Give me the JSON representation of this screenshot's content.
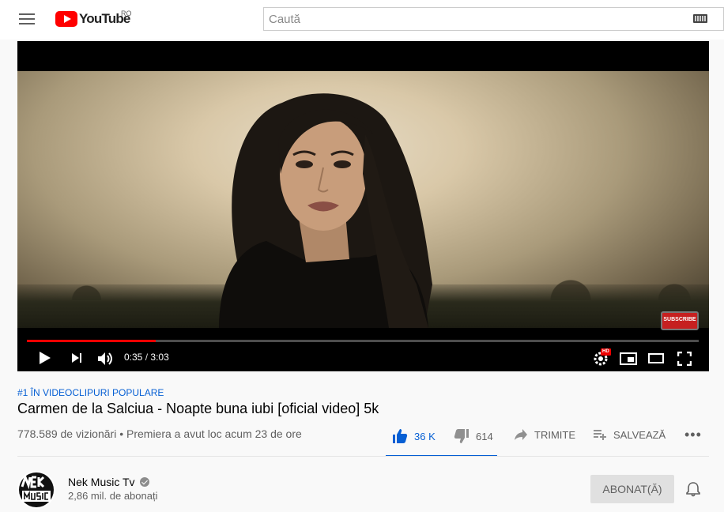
{
  "header": {
    "logo_text": "YouTube",
    "country_code": "RO",
    "search_placeholder": "Caută"
  },
  "player": {
    "current_time": "0:35",
    "time_separator": "/",
    "duration": "3:03",
    "progress_fraction": 0.192,
    "subscribe_watermark": "SUBSCRIBE",
    "hd_badge": "HD"
  },
  "video": {
    "hashtag": "#1 ÎN VIDEOCLIPURI POPULARE",
    "title": "Carmen de la Salciua - Noapte buna iubi [oficial video] 5k",
    "views": "778.589 de vizionări",
    "meta_separator": "•",
    "premiere": "Premiera a avut loc acum 23 de ore"
  },
  "actions": {
    "like_count": "36 K",
    "dislike_count": "614",
    "share_label": "TRIMITE",
    "save_label": "SALVEAZĂ",
    "more_label": "•••"
  },
  "channel": {
    "name": "Nek Music Tv",
    "subscribers": "2,86 mil. de abonați",
    "subscribe_state_label": "ABONAT(Ă)"
  },
  "colors": {
    "accent": "#065fd4",
    "brand_red": "#ff0000",
    "progress_played": "#ff0000"
  }
}
